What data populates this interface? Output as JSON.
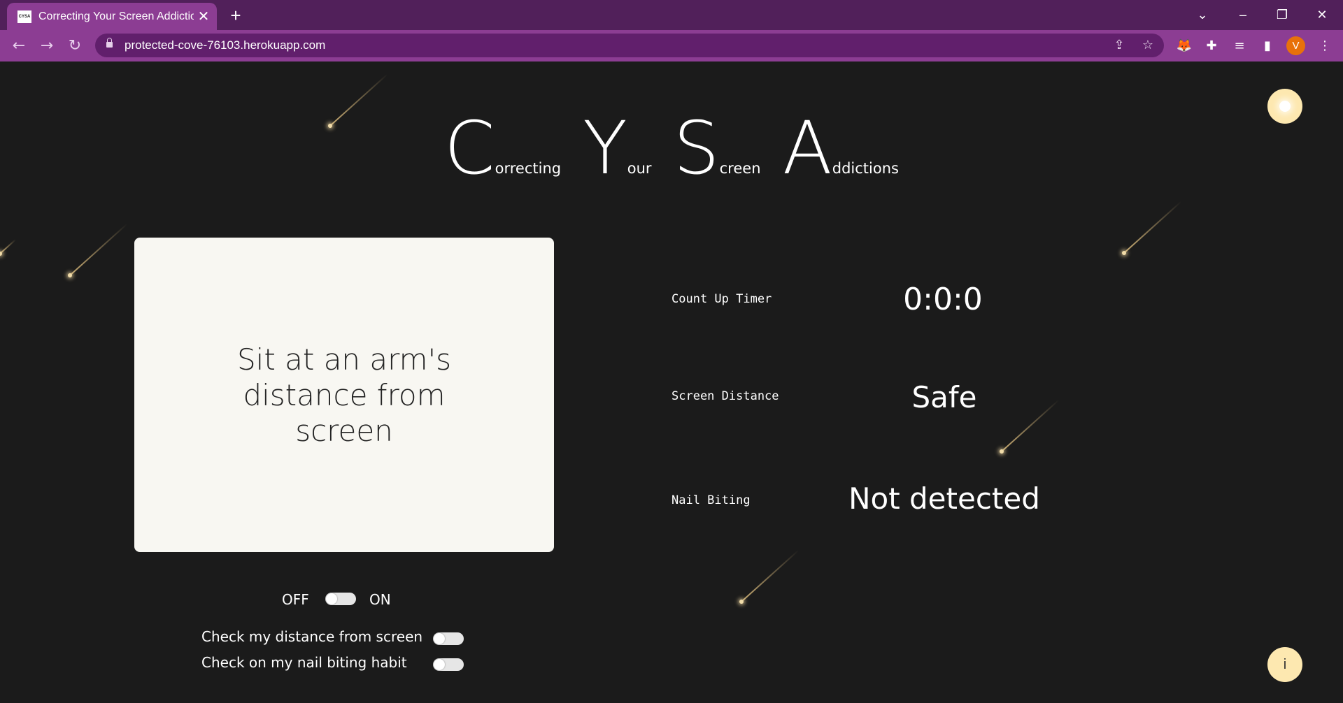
{
  "browser": {
    "tab_title": "Correcting Your Screen Addiction",
    "tab_favicon_text": "CYSA",
    "url": "protected-cove-76103.herokuapp.com",
    "avatar_letter": "V"
  },
  "header": {
    "words": [
      {
        "initial": "C",
        "rest": "orrecting"
      },
      {
        "initial": "Y",
        "rest": "our"
      },
      {
        "initial": "S",
        "rest": "creen"
      },
      {
        "initial": "A",
        "rest": "ddictions"
      }
    ]
  },
  "card": {
    "message": "Sit at an arm's distance from screen"
  },
  "stats": {
    "timer_label": "Count Up Timer",
    "timer_value": "0:0:0",
    "distance_label": "Screen Distance",
    "distance_value": "Safe",
    "nail_label": "Nail Biting",
    "nail_value": "Not detected"
  },
  "controls": {
    "off_label": "OFF",
    "on_label": "ON",
    "master_on": false,
    "check_distance_label": "Check my distance from screen",
    "check_distance_on": false,
    "check_nail_label": "Check on my nail biting habit",
    "check_nail_on": false
  },
  "buttons": {
    "info_label": "i",
    "theme_icon": "sun-icon"
  },
  "colors": {
    "tabbar": "#51205a",
    "toolbar": "#8c3d93",
    "page_background": "#1b1b1b",
    "card_background": "#f8f7f2",
    "round_button": "#fde8b0"
  }
}
